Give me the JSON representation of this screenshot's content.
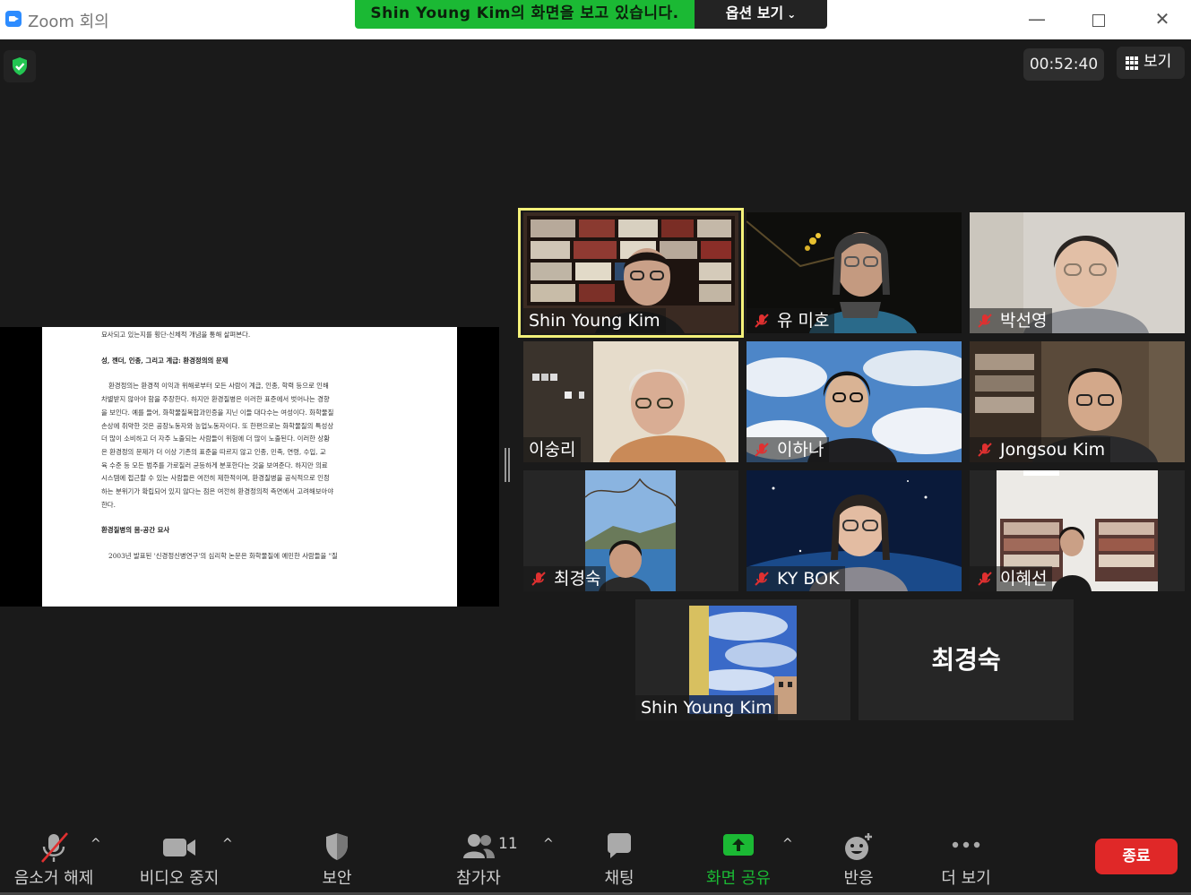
{
  "window": {
    "app_title": "Zoom 회의"
  },
  "share_banner": {
    "text": "Shin Young Kim의 화면을 보고 있습니다.",
    "options_label": "옵션 보기"
  },
  "meeting": {
    "timer": "00:52:40",
    "view_label": "보기"
  },
  "shared_document": {
    "lines": [
      {
        "text": "묘사되고 있는지를 횡단-신체적 개념을 통해 살펴본다.",
        "style": "normal"
      },
      {
        "text": "",
        "style": "gap"
      },
      {
        "text": "성, 젠더, 인종, 그리고 계급: 환경정의의 문제",
        "style": "heading"
      },
      {
        "text": "",
        "style": "gap"
      },
      {
        "text": "환경정의는 환경적 이익과 위해로부터 모든 사람이 계급, 인종, 학력 등으로 인해",
        "style": "indent"
      },
      {
        "text": "차별받지 않아야 함을 주장한다. 하지만 환경질병은 이러한 표준에서 벗어나는 경향",
        "style": "normal"
      },
      {
        "text": "을 보인다. 예를 들어, 화학물질복합과민증을 지닌 이들 대다수는 여성이다. 화학물질",
        "style": "normal"
      },
      {
        "text": "손상에 취약한 것은 공장노동자와 농업노동자이다. 또 한편으로는 화학물질의 특성상",
        "style": "normal"
      },
      {
        "text": "더 많이 소비하고 더 자주 노출되는 사람들이 위험에 더 많이 노출된다. 이러한 상황",
        "style": "normal"
      },
      {
        "text": "은 환경정의 문제가 더 이상 기존의 표준을 따르지 않고 인종, 민족, 연령, 수입, 교",
        "style": "normal"
      },
      {
        "text": "육 수준 등 모든 범주를 가로질러 균등하게 분포한다는 것을 보여준다. 하지만 의료",
        "style": "normal"
      },
      {
        "text": "시스템에 접근할 수 있는 사람들은 여전히 제한적이며, 환경질병을 공식적으로 인정",
        "style": "normal"
      },
      {
        "text": "하는 분위기가 확립되어 있지 않다는 점은 여전히 환경정의적 측면에서 고려해보아야",
        "style": "normal"
      },
      {
        "text": "한다.",
        "style": "normal"
      },
      {
        "text": "",
        "style": "gap"
      },
      {
        "text": "환경질병의 몸-공간 묘사",
        "style": "heading"
      },
      {
        "text": "",
        "style": "gap"
      },
      {
        "text": "2003년 발표된 '신경정신병연구'의 심리학 논문은 화학물질에 예민한 사람들을 \"질",
        "style": "indent"
      }
    ]
  },
  "participants": [
    {
      "name": "Shin Young Kim",
      "muted": false,
      "speaking": true
    },
    {
      "name": "유 미호",
      "muted": true
    },
    {
      "name": "박선영",
      "muted": true
    },
    {
      "name": "이숭리",
      "muted": false
    },
    {
      "name": "이하나",
      "muted": true
    },
    {
      "name": "Jongsou Kim",
      "muted": true
    },
    {
      "name": "최경숙",
      "muted": true
    },
    {
      "name": "KY BOK",
      "muted": true
    },
    {
      "name": "이혜선",
      "muted": true
    },
    {
      "name": "Shin Young Kim",
      "muted": false
    },
    {
      "name": "최경숙",
      "muted": false,
      "video_off": true
    }
  ],
  "toolbar": {
    "unmute": "음소거 해제",
    "stop_video": "비디오 중지",
    "security": "보안",
    "participants": "참가자",
    "participants_count": "11",
    "chat": "채팅",
    "share_screen": "화면 공유",
    "reactions": "반응",
    "more": "더 보기",
    "end": "종료"
  },
  "colors": {
    "accent_green": "#1bb934",
    "speaking_border": "#f4f17a",
    "end_red": "#e02828",
    "muted_red": "#e03030"
  }
}
